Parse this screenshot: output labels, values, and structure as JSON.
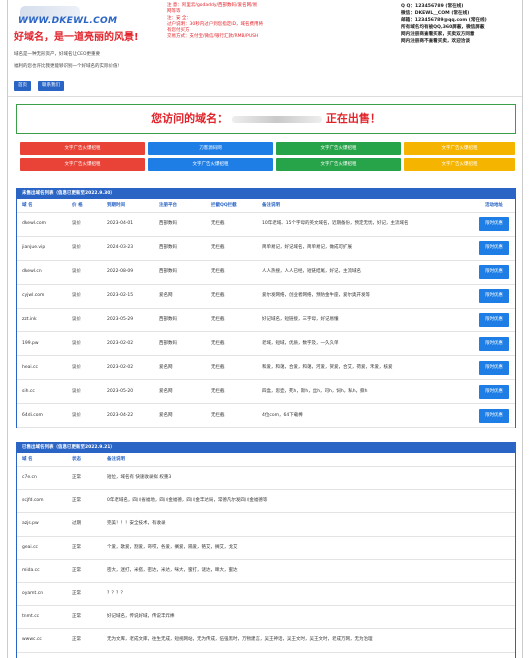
{
  "header": {
    "logo_text": "WWW.DKEWL.COM",
    "slogan": "好域名，是一道亮丽的风景!",
    "desc1": "域名是一种无形资产，好域名让CEO更重要",
    "desc2": "福利的您也许比我更能够识别一个好域名的实际价值!",
    "nav": [
      "首页",
      "联系我们"
    ],
    "mid_info": [
      "注 意：阿里云/godaddy/西部数码/爱名网/易",
      "网等等",
      "注：安 全：",
      "过户说明：30秒内过户到您指定ID，域名费用将",
      "有您付买方",
      "交易方式：支付宝/微信/银行汇款/RMB/PUSH"
    ],
    "contact": [
      {
        "label": "Q Q：123456789 (常在线)",
        "bold": true
      },
      {
        "label": "微信：DKEWL__COM (常在线)",
        "bold": true
      },
      {
        "label": "邮箱：123456789@qq.com (常在线)",
        "bold": true
      },
      {
        "label": "所有域名均有被QQ,360屏蔽，微信屏蔽",
        "bold": true
      },
      {
        "label": "网内注册商查看买家，买卖双方同意",
        "bold": true
      },
      {
        "label": "网内注册商不查看买卖，欢迎洽谈",
        "bold": true
      }
    ]
  },
  "banner": {
    "prefix": "您访问的域名：",
    "suffix": "正在出售！"
  },
  "ads": [
    {
      "label": "文字广告火爆招租",
      "color": "#e94236"
    },
    {
      "label": "刀客源码网",
      "color": "#1e7ee6"
    },
    {
      "label": "文字广告火爆招租",
      "color": "#27a34a"
    },
    {
      "label": "文字广告火爆招租",
      "color": "#f5b400"
    },
    {
      "label": "文字广告火爆招租",
      "color": "#e94236"
    },
    {
      "label": "文字广告火爆招租",
      "color": "#1e7ee6"
    },
    {
      "label": "文字广告火爆招租",
      "color": "#27a34a"
    },
    {
      "label": "文字广告火爆招租",
      "color": "#f5b400"
    }
  ],
  "unsold": {
    "title": "未售出域名列表（信息已更新至2022.9.30）",
    "headers": [
      "域 名",
      "价 格",
      "到期时间",
      "注册平台",
      "拦截QQ拦截",
      "备注说明",
      "活动地址"
    ],
    "rows": [
      {
        "domain": "dkewl.com",
        "price": "议价",
        "expire": "2023-04-01",
        "platform": "西部数码",
        "qq": "无拦截",
        "note": "10年老域、15个字母的英文域名，近期备份，预定无忧，好记，主流域名",
        "btn": "限时优惠"
      },
      {
        "domain": "jianjue.vip",
        "price": "议价",
        "expire": "2024-03-23",
        "platform": "西部数码",
        "qq": "无拦截",
        "note": "简单易记，好记域名，简单易记，做成可扩展",
        "btn": "限时优惠"
      },
      {
        "domain": "dkewl.cn",
        "price": "议价",
        "expire": "2022-08-09",
        "platform": "西部数码",
        "qq": "无拦截",
        "note": "人人热搜，人人已经，短链结尾，好记，主流域名",
        "btn": "限时优惠"
      },
      {
        "domain": "cyjwl.com",
        "price": "议价",
        "expire": "2023-02-15",
        "platform": "爱名网",
        "qq": "无拦截",
        "note": "爱尔发网络，创业者网络，预防金牛座，爱尔奥开发等",
        "btn": "限时优惠"
      },
      {
        "domain": "zzt.ink",
        "price": "议价",
        "expire": "2023-05-29",
        "platform": "西部数码",
        "qq": "无拦截",
        "note": "好记域名，短链接，三字母，好记易懂",
        "btn": "限时优惠"
      },
      {
        "domain": "199.pw",
        "price": "议价",
        "expire": "2023-02-02",
        "platform": "西部数码",
        "qq": "无拦截",
        "note": "老域，短域，优质，数字及，一久久单",
        "btn": "限时优惠"
      },
      {
        "domain": "heai.cc",
        "price": "议价",
        "expire": "2023-02-02",
        "platform": "爱名网",
        "qq": "无拦截",
        "note": "和爱，和蔼，合爱，和蔼，河爱，贺爱，合艾，荷爱，禾爱，核爱",
        "btn": "限时优惠"
      },
      {
        "domain": "sih.cc",
        "price": "议价",
        "expire": "2023-05-20",
        "platform": "爱名网",
        "qq": "无拦截",
        "note": "四盒，思壶，死h，斯h，丝h，司h，饲h，私h，撕h",
        "btn": "限时优惠"
      },
      {
        "domain": "64di.com",
        "price": "议价",
        "expire": "2023-04-22",
        "platform": "爱名网",
        "qq": "无拦截",
        "note": "4位com，64下载棒",
        "btn": "限时优惠"
      }
    ]
  },
  "sold": {
    "title": "已售出域名列表（信息已更新至2022.9.21）",
    "headers": [
      "域 名",
      "状态",
      "备注说明"
    ],
    "rows": [
      {
        "domain": "c7e.cn",
        "status": "正常",
        "note": "短位，域名有 快速收录拟 权重3"
      },
      {
        "domain": "scjfd.com",
        "status": "正常",
        "note": "0年老域名，四川省福地，四川金福德，四川金丰达局，常德凡尔发四川金福德等"
      },
      {
        "domain": "azjs.pw",
        "status": "过期",
        "note": "完美！！！安全技术，有收录"
      },
      {
        "domain": "geai.cc",
        "status": "正常",
        "note": "个爱，歌爱，割爱，哥哎，各爱，搁爱，隔爱，铬艾，搁艾，戈艾"
      },
      {
        "domain": "mida.cc",
        "status": "正常",
        "note": "密大，迷打，米搭，密达，米达，咪大，蜜打，谜达，眯大，蜜达"
      },
      {
        "domain": "oyamt.cn",
        "status": "正常",
        "note": "？？？？"
      },
      {
        "domain": "tnmt.cc",
        "status": "正常",
        "note": "好记域名，传说好域，传说丰炸棒"
      },
      {
        "domain": "wwwc.cc",
        "status": "正常",
        "note": "无为文库，老成文库，往生无成，短视网站，无为传成，伍强黑时，万物建言，吴王神话，吴王文时，吴王文时，老成万网，无为治理"
      },
      {
        "domain": "ysup.cn",
        "status": "正常",
        "note": "有收录，好记域名，无拦截"
      }
    ]
  }
}
